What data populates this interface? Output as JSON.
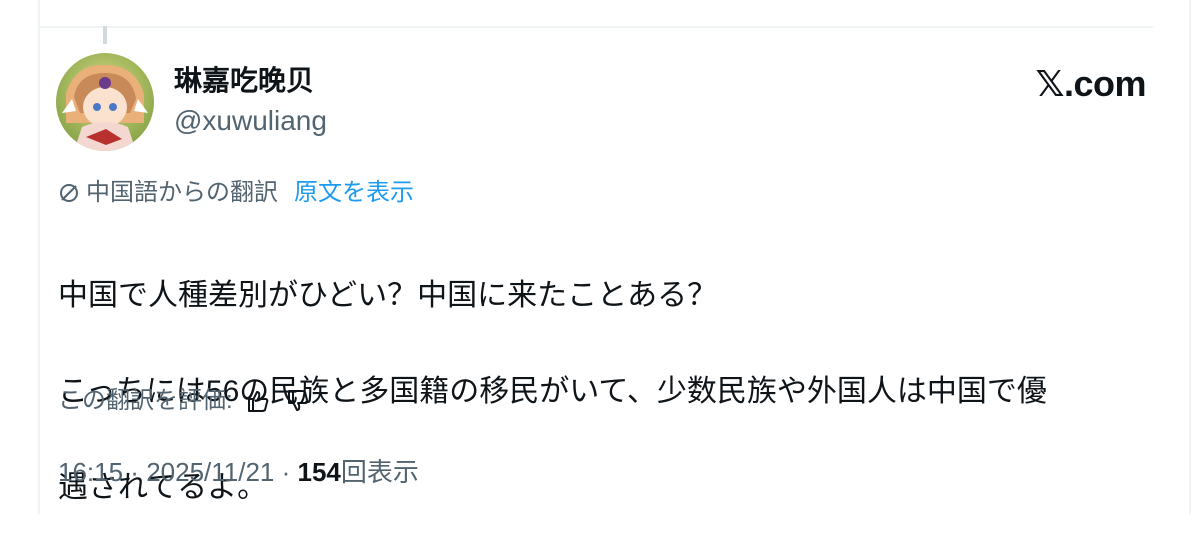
{
  "author": {
    "display_name": "琳嘉吃晚贝",
    "handle": "@xuwuliang"
  },
  "brand": {
    "x_glyph": "𝕏",
    "suffix": ".com"
  },
  "translation": {
    "source_label": "中国語からの翻訳",
    "show_original": "原文を表示",
    "icon": "translate-icon"
  },
  "tweet": {
    "line1": "中国で人種差別がひどい？中国に来たことある？",
    "line2": "こっちには56の民族と多国籍の移民がいて、少数民族や外国人は中国で優",
    "line3": "遇されてるよ。"
  },
  "rating": {
    "label": "この翻訳を評価:",
    "thumbs_up_icon": "thumbs-up-icon",
    "thumbs_down_icon": "thumbs-down-icon"
  },
  "meta": {
    "time": "16:15",
    "sep1": " · ",
    "date": "2025/11/21",
    "sep2": " · ",
    "views": "154",
    "views_label": "回表示"
  }
}
